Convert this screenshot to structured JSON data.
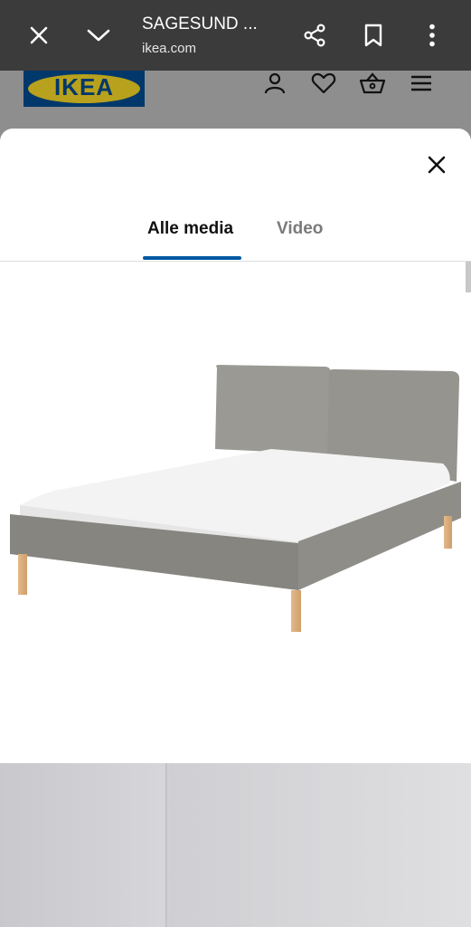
{
  "browser": {
    "title": "SAGESUND ...",
    "url": "ikea.com",
    "icons": [
      "close-icon",
      "chevron-down-icon",
      "share-icon",
      "bookmark-icon",
      "more-vert-icon"
    ]
  },
  "site_header": {
    "logo_text": "IKEA",
    "icons": [
      "user-icon",
      "heart-icon",
      "basket-icon",
      "menu-icon"
    ],
    "colors": {
      "logo_blue": "#00386b",
      "logo_yellow": "#b8a11c"
    }
  },
  "media_modal": {
    "tabs": [
      {
        "label": "Alle media",
        "active": true
      },
      {
        "label": "Video",
        "active": false
      }
    ],
    "accent_color": "#0058a3"
  }
}
